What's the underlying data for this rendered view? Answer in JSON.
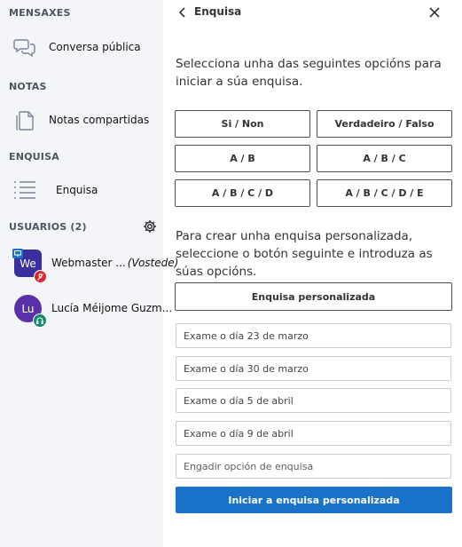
{
  "sidebar": {
    "sections": {
      "messages": "MENSAXES",
      "notes": "NOTAS",
      "poll": "ENQUISA",
      "users": "USUARIOS (2)"
    },
    "items": {
      "public_chat": "Conversa pública",
      "shared_notes": "Notas compartidas",
      "poll": "Enquisa"
    },
    "users": [
      {
        "initials": "We",
        "name": "Webmaster ...",
        "suffix": "(Vostede)",
        "color": "#3a2f9e"
      },
      {
        "initials": "Lu",
        "name": "Lucía Méijome Guzm...",
        "color": "#5a2fa8"
      }
    ]
  },
  "panel": {
    "title": "Enquisa",
    "intro": "Selecciona unha das seguintes opcións para iniciar a súa enquisa.",
    "options": [
      "Si / Non",
      "Verdadeiro / Falso",
      "A / B",
      "A / B / C",
      "A / B / C / D",
      "A / B / C / D / E"
    ],
    "custom_intro": "Para crear unha enquisa personalizada, seleccione o botón seguinte e introduza as súas opcións.",
    "custom_button": "Enquisa personalizada",
    "fields": [
      "Exame o día 23 de marzo",
      "Exame o día 30 de marzo",
      "Exame o día 5 de abril",
      "Exame o día 9 de abril"
    ],
    "add_option_placeholder": "Engadir opción de enquisa",
    "start_button": "Iniciar a enquisa personalizada"
  },
  "colors": {
    "accent": "#1a73c8",
    "sidebar_bg": "#f3f5f8"
  }
}
